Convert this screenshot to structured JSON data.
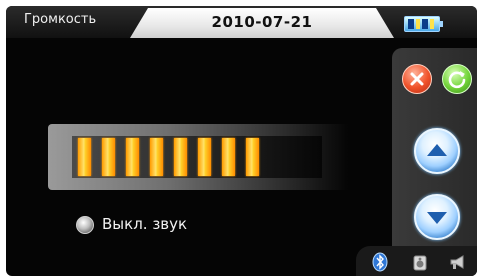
{
  "header": {
    "title": "Громкость",
    "date": "2010-07-21"
  },
  "volume": {
    "level_segments": 8
  },
  "mute": {
    "label": "Выкл. звук"
  },
  "icons": {
    "battery": "battery-icon",
    "close": "close-icon",
    "refresh": "refresh-icon",
    "up": "arrow-up-icon",
    "down": "arrow-down-icon",
    "bluetooth": "bluetooth-icon",
    "speaker": "speaker-icon",
    "horn": "megaphone-icon"
  },
  "colors": {
    "accent_orange": "#ffb21a",
    "blue_button": "#2b78c8",
    "close_red": "#f0522a",
    "refresh_green": "#73d43a"
  }
}
